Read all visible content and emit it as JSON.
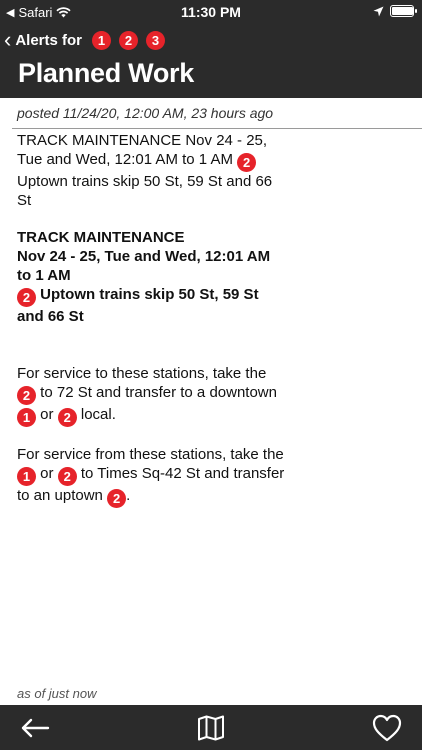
{
  "status_bar": {
    "carrier": "Safari",
    "time": "11:30 PM",
    "battery_level": 0.95
  },
  "nav": {
    "back_label": "Alerts for",
    "back_routes": [
      "1",
      "2",
      "3"
    ],
    "title": "Planned Work"
  },
  "posted": "posted 11/24/20, 12:00 AM, 23 hours ago",
  "alert": {
    "header": {
      "line1": "TRACK  MAINTENANCE Nov 24 - 25, Tue  and  Wed, 12:01 AM to 1 AM",
      "route": "2",
      "line2": "Uptown trains skip 50 St, 59 St and 66  St"
    },
    "body_heading": {
      "line1": "TRACK MAINTENANCE",
      "line2": "Nov 24 - 25, Tue and Wed, 12:01 AM to 1 AM",
      "route": "2",
      "line3": "Uptown trains skip 50 St, 59 St and 66 St"
    },
    "para1": {
      "t1": "For service to these stations, take the",
      "r1": "2",
      "t2": "to 72 St and transfer to a downtown",
      "r2": "1",
      "t3": "or",
      "r3": "2",
      "t4": "local."
    },
    "para2": {
      "t1": "For service from these stations, take the",
      "r1": "1",
      "t2": "or",
      "r2": "2",
      "t3": "to Times Sq-42 St and transfer to an uptown",
      "r3": "2",
      "t4": "."
    }
  },
  "as_of": "as of just now",
  "toolbar": {
    "back_icon": "arrow-left-icon",
    "map_icon": "map-icon",
    "favorite_icon": "heart-icon"
  },
  "colors": {
    "bar_bg": "#2b2b2b",
    "route_123": "#e6232a"
  }
}
